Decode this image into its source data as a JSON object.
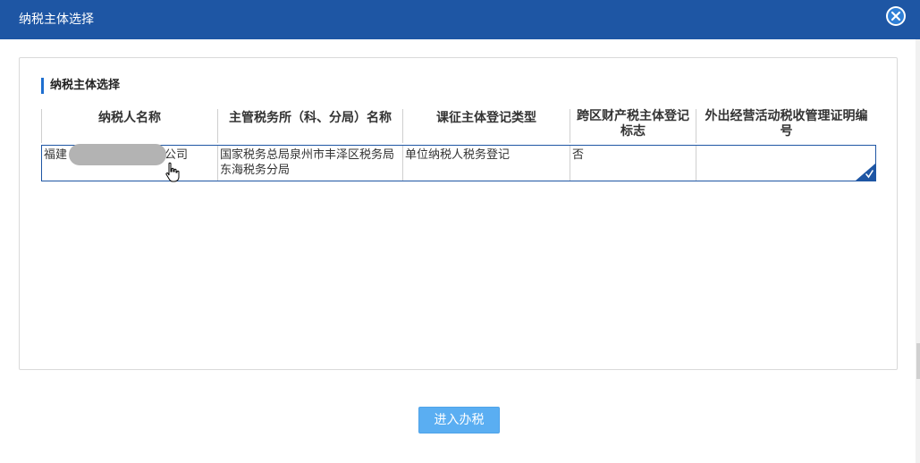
{
  "dialog": {
    "title": "纳税主体选择",
    "close_icon": "close-icon"
  },
  "section": {
    "title": "纳税主体选择"
  },
  "table": {
    "headers": [
      "纳税人名称",
      "主管税务所（科、分局）名称",
      "课征主体登记类型",
      "跨区财产税主体登记标志",
      "外出经营活动税收管理证明编号"
    ],
    "rows": [
      {
        "name_prefix": "福建",
        "name_suffix": "公司",
        "tax_office": "国家税务总局泉州市丰泽区税务局东海税务分局",
        "registration_type": "单位纳税人税务登记",
        "cross_region_flag": "否",
        "outbound_cert_no": "",
        "selected": true
      }
    ]
  },
  "footer": {
    "enter_button": "进入办税"
  },
  "colors": {
    "titlebar": "#1e56a4",
    "accent": "#1e6fd0",
    "button": "#5aaef2"
  }
}
